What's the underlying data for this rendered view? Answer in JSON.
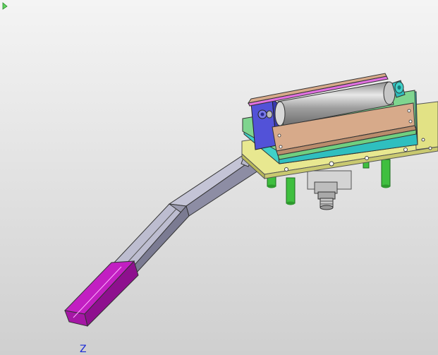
{
  "viewport": {
    "background_top": "#f4f4f4",
    "background_bottom": "#cfcfcf"
  },
  "model": {
    "colors": {
      "base_plate": "#e6e68e",
      "mount_plate_teal": "#3fd0c8",
      "mount_plate_green": "#7fd58f",
      "side_panel": "#d7aa8a",
      "roller": "#a8a8a8",
      "end_block": "#6e6ee0",
      "chute": "#b3b3c8",
      "chute_tip": "#b21cb2",
      "standoff": "#38b838",
      "motor": "#d0d0d0",
      "accent_magenta": "#ff00ff",
      "accent_teal": "#2fbfbf"
    }
  },
  "axis": {
    "z_label": "Z",
    "color": "#1a2ad6",
    "triad_icon": "triad-arrow-icon"
  }
}
